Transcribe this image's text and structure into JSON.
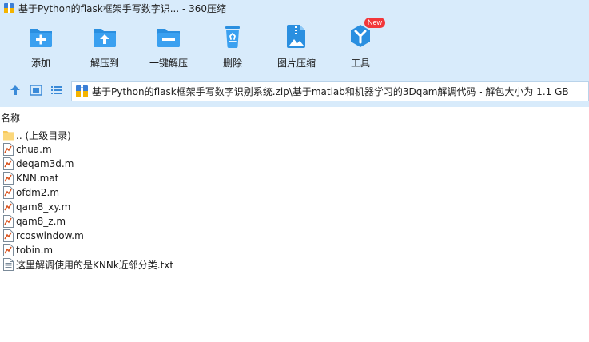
{
  "window": {
    "title": "基于Python的flask框架手写数字识... - 360压缩"
  },
  "toolbar": {
    "items": [
      {
        "label": "添加",
        "icon": "add-folder-icon"
      },
      {
        "label": "解压到",
        "icon": "extract-folder-icon"
      },
      {
        "label": "一键解压",
        "icon": "one-click-extract-icon"
      },
      {
        "label": "删除",
        "icon": "recycle-bin-icon"
      },
      {
        "label": "图片压缩",
        "icon": "image-compress-icon"
      },
      {
        "label": "工具",
        "icon": "tools-icon",
        "badge": "New"
      }
    ]
  },
  "navigation": {
    "path": "基于Python的flask框架手写数字识别系统.zip\\基于matlab和机器学习的3Dqam解调代码 - 解包大小为 1.1 GB"
  },
  "file_list": {
    "column_header": "名称",
    "items": [
      {
        "name": ".. (上级目录)",
        "type": "folder"
      },
      {
        "name": "chua.m",
        "type": "m-file"
      },
      {
        "name": "deqam3d.m",
        "type": "m-file"
      },
      {
        "name": "KNN.mat",
        "type": "m-file"
      },
      {
        "name": "ofdm2.m",
        "type": "m-file"
      },
      {
        "name": "qam8_xy.m",
        "type": "m-file"
      },
      {
        "name": "qam8_z.m",
        "type": "m-file"
      },
      {
        "name": "rcoswindow.m",
        "type": "m-file"
      },
      {
        "name": "tobin.m",
        "type": "m-file"
      },
      {
        "name": "这里解调使用的是KNNk近邻分类.txt",
        "type": "text-file"
      }
    ]
  },
  "colors": {
    "toolbar_bg": "#d8ebfb",
    "icon_blue": "#2a8fe0",
    "badge_red": "#f2363a"
  }
}
